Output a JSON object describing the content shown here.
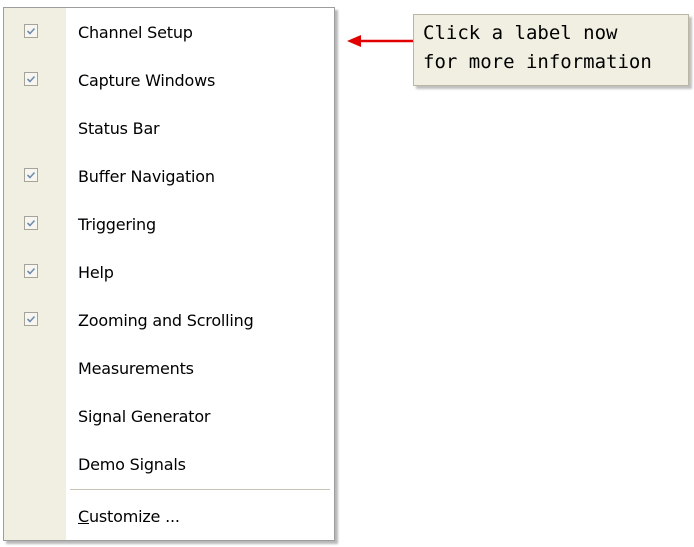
{
  "menu": {
    "items": [
      {
        "label": "Channel Setup",
        "checked": true
      },
      {
        "label": "Capture Windows",
        "checked": true
      },
      {
        "label": "Status Bar",
        "checked": false
      },
      {
        "label": "Buffer Navigation",
        "checked": true
      },
      {
        "label": "Triggering",
        "checked": true
      },
      {
        "label": "Help",
        "checked": true
      },
      {
        "label": "Zooming and Scrolling",
        "checked": true
      },
      {
        "label": "Measurements",
        "checked": false
      },
      {
        "label": "Signal Generator",
        "checked": false
      },
      {
        "label": "Demo Signals",
        "checked": false
      }
    ],
    "customize": {
      "accelerator": "C",
      "rest": "ustomize ..."
    }
  },
  "callout": {
    "line1": "Click a label now",
    "line2": "for more information"
  },
  "colors": {
    "gutter": "#f1efe2",
    "arrow": "#e00000",
    "check": "#6f8fae"
  },
  "icons": {
    "checkbox": "checkbox-checked-icon",
    "arrow": "arrow-left-icon"
  }
}
